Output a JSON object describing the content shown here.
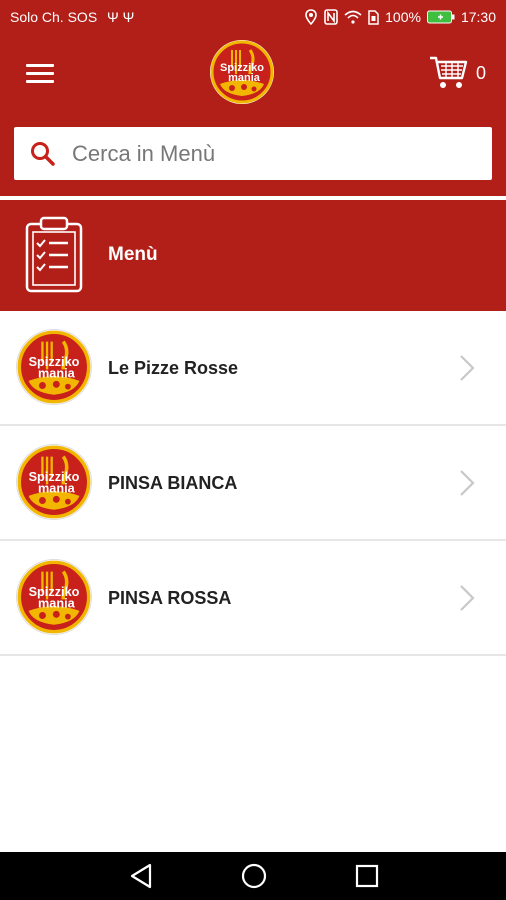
{
  "status_bar": {
    "carrier": "Solo Ch. SOS",
    "battery": "100%",
    "time": "17:30"
  },
  "header": {
    "logo_text_line1": "Spizziko",
    "logo_text_line2": "mania",
    "cart_count": "0"
  },
  "search": {
    "placeholder": "Cerca in Menù"
  },
  "section": {
    "title": "Menù"
  },
  "categories": [
    {
      "label": "Le Pizze Rosse"
    },
    {
      "label": "PINSA BIANCA"
    },
    {
      "label": "PINSA ROSSA"
    }
  ],
  "colors": {
    "brand_red": "#b21f18"
  }
}
